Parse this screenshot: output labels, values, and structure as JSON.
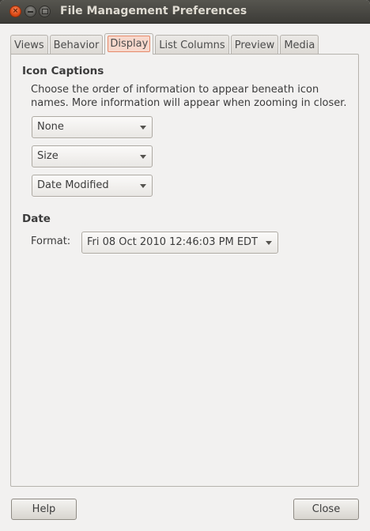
{
  "window": {
    "title": "File Management Preferences"
  },
  "titlebar_buttons": {
    "close": "×"
  },
  "tabs": [
    {
      "label": "Views"
    },
    {
      "label": "Behavior"
    },
    {
      "label": "Display",
      "active": true
    },
    {
      "label": "List Columns"
    },
    {
      "label": "Preview"
    },
    {
      "label": "Media"
    }
  ],
  "icon_captions": {
    "heading": "Icon Captions",
    "description": "Choose the order of information to appear beneath icon names. More information will appear when zooming in closer.",
    "combos": [
      {
        "value": "None"
      },
      {
        "value": "Size"
      },
      {
        "value": "Date Modified"
      }
    ]
  },
  "date": {
    "heading": "Date",
    "format_label": "Format:",
    "format_value": "Fri 08 Oct 2010 12:46:03 PM EDT"
  },
  "buttons": {
    "help": "Help",
    "close": "Close"
  },
  "colors": {
    "titlebar": "#3c3b37",
    "window_bg": "#f2f1f0",
    "close_button": "#df4a16",
    "active_tab_highlight": "#f7d8cc"
  },
  "icons": [
    "close-icon",
    "minimize-icon",
    "maximize-icon",
    "dropdown-arrow-icon"
  ]
}
